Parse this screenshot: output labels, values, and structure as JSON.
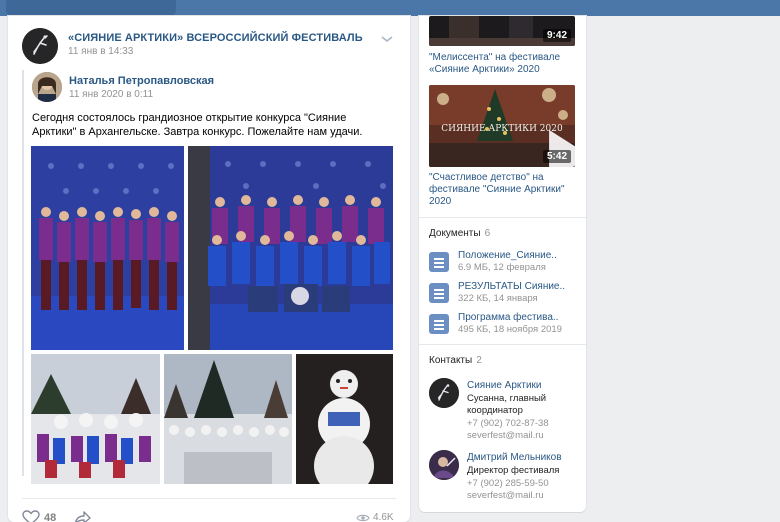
{
  "post": {
    "group_name": "«СИЯНИЕ АРКТИКИ» ВСЕРОССИЙСКИЙ ФЕСТИВАЛЬ",
    "date": "11 янв в 14:33",
    "repost": {
      "author": "Наталья Петропавловская",
      "date": "11 янв 2020 в 0:11",
      "text": "Сегодня состоялось грандиозное открытие конкурса \"Сияние Арктики\" в Архангельске. Завтра конкурс. Пожелайте нам удачи."
    },
    "likes": "48",
    "views": "4.6K"
  },
  "sidebar": {
    "videos": [
      {
        "title": "\"Мелиссента\" на фестивале «Сияние Арктики» 2020",
        "duration": "9:42"
      },
      {
        "title": "\"Счастливое детство\" на фестивале \"Сияние Арктики\" 2020",
        "duration": "5:42",
        "overlay_text": "СИЯНИЕ АРКТИКИ 2020"
      }
    ],
    "documents_label": "Документы",
    "documents_count": "6",
    "documents": [
      {
        "name": "Положение_Сияние..",
        "meta": "6.9 МБ, 12 февраля"
      },
      {
        "name": "РЕЗУЛЬТАТЫ Сияние..",
        "meta": "322 КБ, 14 января"
      },
      {
        "name": "Программа фестива..",
        "meta": "495 КБ, 18 ноября 2019"
      }
    ],
    "contacts_label": "Контакты",
    "contacts_count": "2",
    "contacts": [
      {
        "name": "Сияние Арктики",
        "role_1": "Сусанна, главный",
        "role_2": "координатор",
        "phone": "+7 (902) 702-87-38",
        "email": "severfest@mail.ru"
      },
      {
        "name": "Дмитрий Мельников",
        "role_1": "Директор фестиваля",
        "phone": "+7 (902) 285-59-50",
        "email": "severfest@mail.ru"
      }
    ]
  },
  "colors": {
    "link": "#2a5885",
    "header": "#4a76a8",
    "background": "#edeef0",
    "doc_icon": "#6b8fc3"
  }
}
